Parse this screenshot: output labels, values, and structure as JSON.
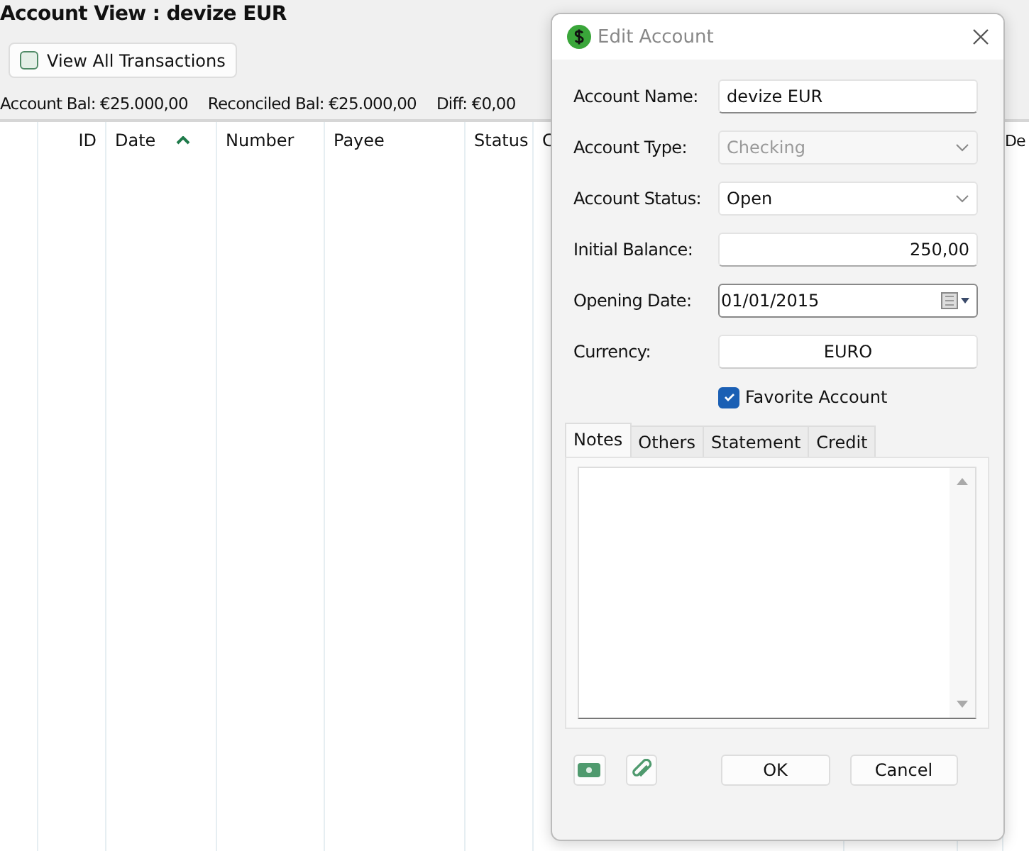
{
  "page": {
    "title": "Account View : devize EUR",
    "view_all": {
      "label": "View All Transactions",
      "checked": false
    },
    "balances": [
      "Account Bal: €25.000,00",
      "Reconciled Bal: €25.000,00",
      "Diff: €0,00"
    ]
  },
  "table": {
    "columns": [
      {},
      {
        "label": "ID"
      },
      {
        "label": "Date",
        "sorted": true
      },
      {
        "label": "Number"
      },
      {
        "label": "Payee"
      },
      {
        "label": "Status"
      },
      {
        "label": "C"
      },
      {},
      {},
      {
        "label": "De"
      }
    ]
  },
  "dialog": {
    "title": "Edit Account",
    "fields": [
      {
        "kind": "text",
        "label": "Account Name:",
        "value": "devize EUR",
        "disabled": false
      },
      {
        "kind": "select",
        "label": "Account Type:",
        "value": "Checking",
        "disabled": true
      },
      {
        "kind": "select",
        "label": "Account Status:",
        "value": "Open",
        "disabled": false
      },
      {
        "kind": "number",
        "label": "Initial Balance:",
        "value": "250,00",
        "disabled": false
      },
      {
        "kind": "date",
        "label": "Opening Date:",
        "value": "01/01/2015",
        "disabled": false
      },
      {
        "kind": "button",
        "label": "Currency:",
        "value": "EURO",
        "disabled": false
      }
    ],
    "favorite": {
      "label": "Favorite Account",
      "checked": true
    },
    "tabs": [
      {
        "label": "Notes",
        "selected": true
      },
      {
        "label": "Others",
        "selected": false
      },
      {
        "label": "Statement",
        "selected": false
      },
      {
        "label": "Credit",
        "selected": false
      }
    ],
    "buttons": [
      "OK",
      "Cancel"
    ]
  }
}
